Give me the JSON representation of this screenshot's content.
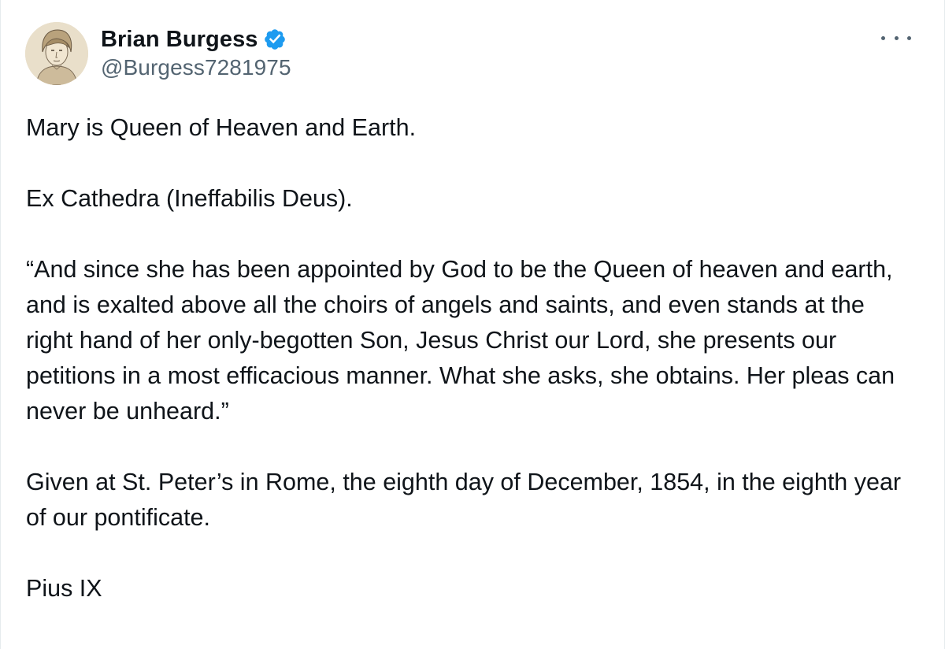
{
  "author": {
    "display_name": "Brian Burgess",
    "handle": "@Burgess7281975",
    "verified": true,
    "avatar_icon": "sketched-portrait-avatar",
    "verified_icon": "verified-badge-icon",
    "verified_color": "#1d9bf0"
  },
  "menu": {
    "icon": "more-options-icon"
  },
  "post": {
    "paragraphs": [
      "Mary is Queen of Heaven and Earth.",
      "Ex Cathedra (Ineffabilis Deus).",
      "“And since she has been appointed by God to be the Queen of heaven and earth, and is exalted above all the choirs of angels and saints, and even stands at the right hand of her only-begotten Son, Jesus Christ our Lord, she presents our petitions in a most efficacious manner. What she asks, she obtains. Her pleas can never be unheard.”",
      "Given at St. Peter’s in Rome, the eighth day of December, 1854, in the eighth year of our pontificate.",
      "Pius IX"
    ]
  },
  "colors": {
    "text": "#0f1419",
    "secondary_text": "#536471"
  }
}
